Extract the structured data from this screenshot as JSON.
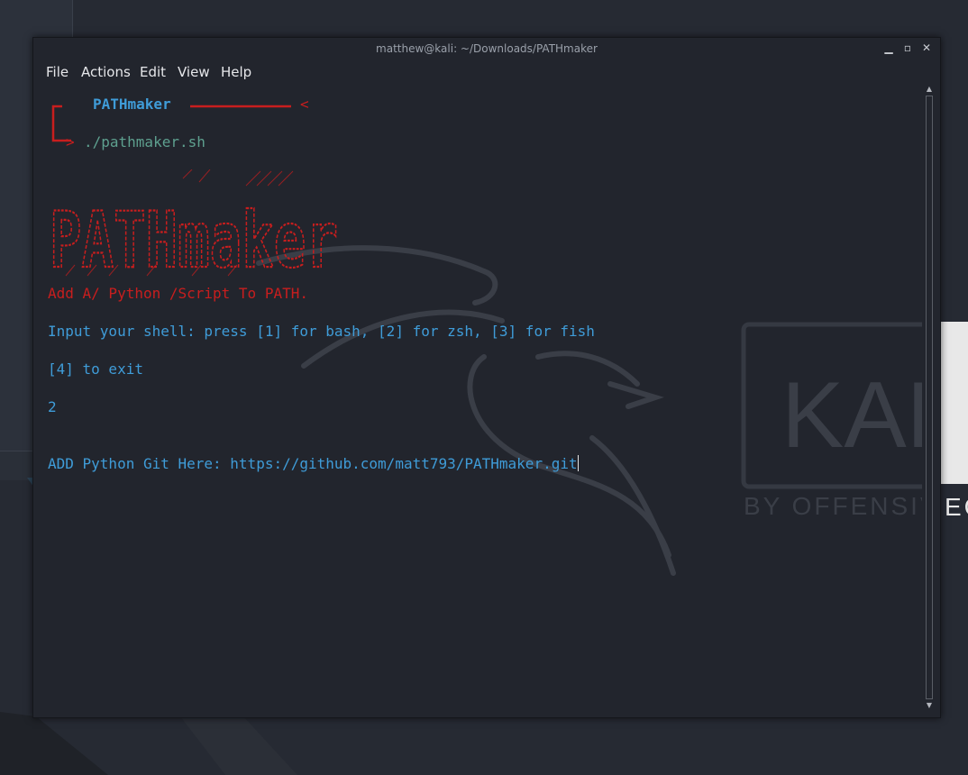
{
  "window": {
    "title": "matthew@kali: ~/Downloads/PATHmaker",
    "minimize_icon": "minimize-icon",
    "maximize_icon": "maximize-icon",
    "close_icon": "close-icon"
  },
  "menu": {
    "file": "File",
    "actions": "Actions",
    "edit": "Edit",
    "view": "View",
    "help": "Help"
  },
  "terminal": {
    "prompt_name": "PATHmaker",
    "prompt_arrow": "<",
    "command": "./pathmaker.sh",
    "banner_text": "PATHmaker",
    "tagline": "Add A/ Python /Script To PATH.",
    "shell_prompt": "Input your shell: press [1] for bash, [2] for zsh, [3] for fish",
    "exit_prompt": "[4] to exit",
    "user_choice": "2",
    "git_prompt": "ADD Python Git Here: https://github.com/matt793/PATHmaker.git"
  },
  "desktop": {
    "kali_logo_text": "KAL",
    "kali_tagline": "BY OFFENSIVE SEC"
  },
  "colors": {
    "terminal_bg": "#22252d",
    "blue_text": "#3f9cd8",
    "red_text": "#c81e1e",
    "green_text": "#5ea08f"
  }
}
